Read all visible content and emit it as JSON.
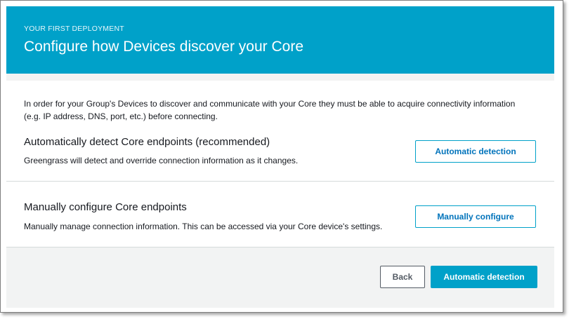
{
  "header": {
    "eyebrow": "YOUR FIRST DEPLOYMENT",
    "title": "Configure how Devices discover your Core"
  },
  "intro": "In order for your Group's Devices to discover and communicate with your Core they must be able to acquire connectivity information (e.g. IP address, DNS, port, etc.) before connecting.",
  "options": [
    {
      "title": "Automatically detect Core endpoints (recommended)",
      "description": "Greengrass will detect and override connection information as it changes.",
      "button_label": "Automatic detection"
    },
    {
      "title": "Manually configure Core endpoints",
      "description": "Manually manage connection information. This can be accessed via your Core device's settings.",
      "button_label": "Manually configure"
    }
  ],
  "footer": {
    "back_label": "Back",
    "primary_label": "Automatic detection"
  },
  "colors": {
    "header_bg": "#00a1c9",
    "link": "#0073bb",
    "page_bg": "#f2f3f3"
  }
}
